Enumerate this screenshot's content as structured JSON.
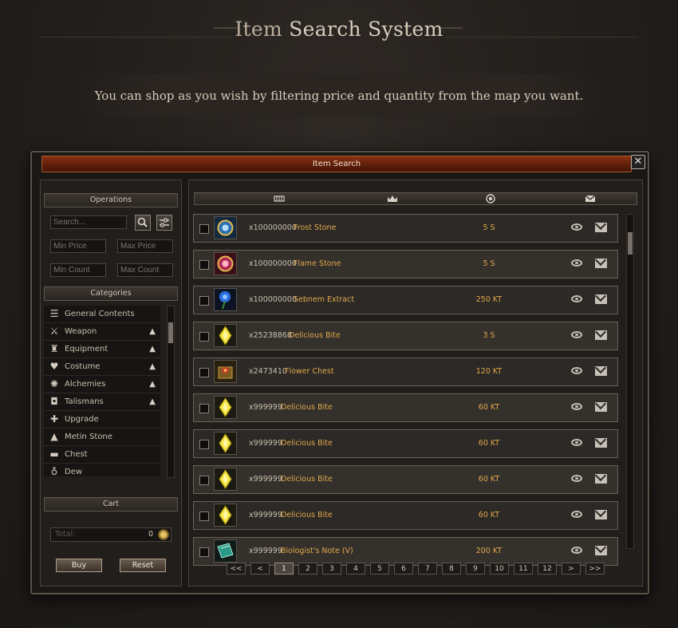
{
  "header": {
    "title_part1": "Item",
    "title_part2": "Search System"
  },
  "banner": {
    "text": "You can shop as you wish by filtering price and quantity from the map you want."
  },
  "window": {
    "title": "Item Search",
    "close_glyph": "✕"
  },
  "operations": {
    "label": "Operations",
    "search_placeholder": "Search...",
    "min_price": "Min Price",
    "max_price": "Max Price",
    "min_count": "Min Count",
    "max_count": "Max Count"
  },
  "categories": {
    "label": "Categories",
    "items": [
      {
        "label": "General Contents",
        "icon": "list-icon",
        "expandable": false
      },
      {
        "label": "Weapon",
        "icon": "sword-icon",
        "expandable": true
      },
      {
        "label": "Equipment",
        "icon": "helmet-icon",
        "expandable": true
      },
      {
        "label": "Costume",
        "icon": "heart-icon",
        "expandable": true
      },
      {
        "label": "Alchemies",
        "icon": "gear-icon",
        "expandable": true
      },
      {
        "label": "Talismans",
        "icon": "talisman-icon",
        "expandable": true
      },
      {
        "label": "Upgrade",
        "icon": "plus-icon",
        "expandable": false
      },
      {
        "label": "Metin Stone",
        "icon": "stone-icon",
        "expandable": false
      },
      {
        "label": "Chest",
        "icon": "chest-icon",
        "expandable": false
      },
      {
        "label": "Dew",
        "icon": "flask-icon",
        "expandable": false
      }
    ]
  },
  "cart": {
    "label": "Cart",
    "total_label": "Total:",
    "total_value": "0",
    "buy_label": "Buy",
    "reset_label": "Reset"
  },
  "columns": [
    "item-count-icon",
    "crown-icon",
    "coin-icon",
    "mail-icon"
  ],
  "items": [
    {
      "qty": "x100000000",
      "name": "Frost Stone",
      "price": "5 S",
      "icon": "frost-stone"
    },
    {
      "qty": "x100000000",
      "name": "Flame Stone",
      "price": "5 S",
      "icon": "flame-stone"
    },
    {
      "qty": "x100000000",
      "name": "Sebnem Extract",
      "price": "250 KT",
      "icon": "blue-rose"
    },
    {
      "qty": "x25238868",
      "name": "Delicious Bite",
      "price": "3 S",
      "icon": "yellow-gem"
    },
    {
      "qty": "x2473410",
      "name": "Flower Chest",
      "price": "120 KT",
      "icon": "flower-chest"
    },
    {
      "qty": "x999999",
      "name": "Delicious Bite",
      "price": "60 KT",
      "icon": "yellow-gem"
    },
    {
      "qty": "x999999",
      "name": "Delicious Bite",
      "price": "60 KT",
      "icon": "yellow-gem"
    },
    {
      "qty": "x999999",
      "name": "Delicious Bite",
      "price": "60 KT",
      "icon": "yellow-gem"
    },
    {
      "qty": "x999999",
      "name": "Delicious Bite",
      "price": "60 KT",
      "icon": "yellow-gem"
    },
    {
      "qty": "x999999",
      "name": "Biologist's Note (V)",
      "price": "200 KT",
      "icon": "green-book"
    }
  ],
  "pagination": {
    "pages": [
      "<<",
      "<",
      "1",
      "2",
      "3",
      "4",
      "5",
      "6",
      "7",
      "8",
      "9",
      "10",
      "11",
      "12",
      ">",
      ">>"
    ],
    "active": "1"
  },
  "colors": {
    "price": "#e2a84a",
    "titlebar": "#6e260c"
  }
}
